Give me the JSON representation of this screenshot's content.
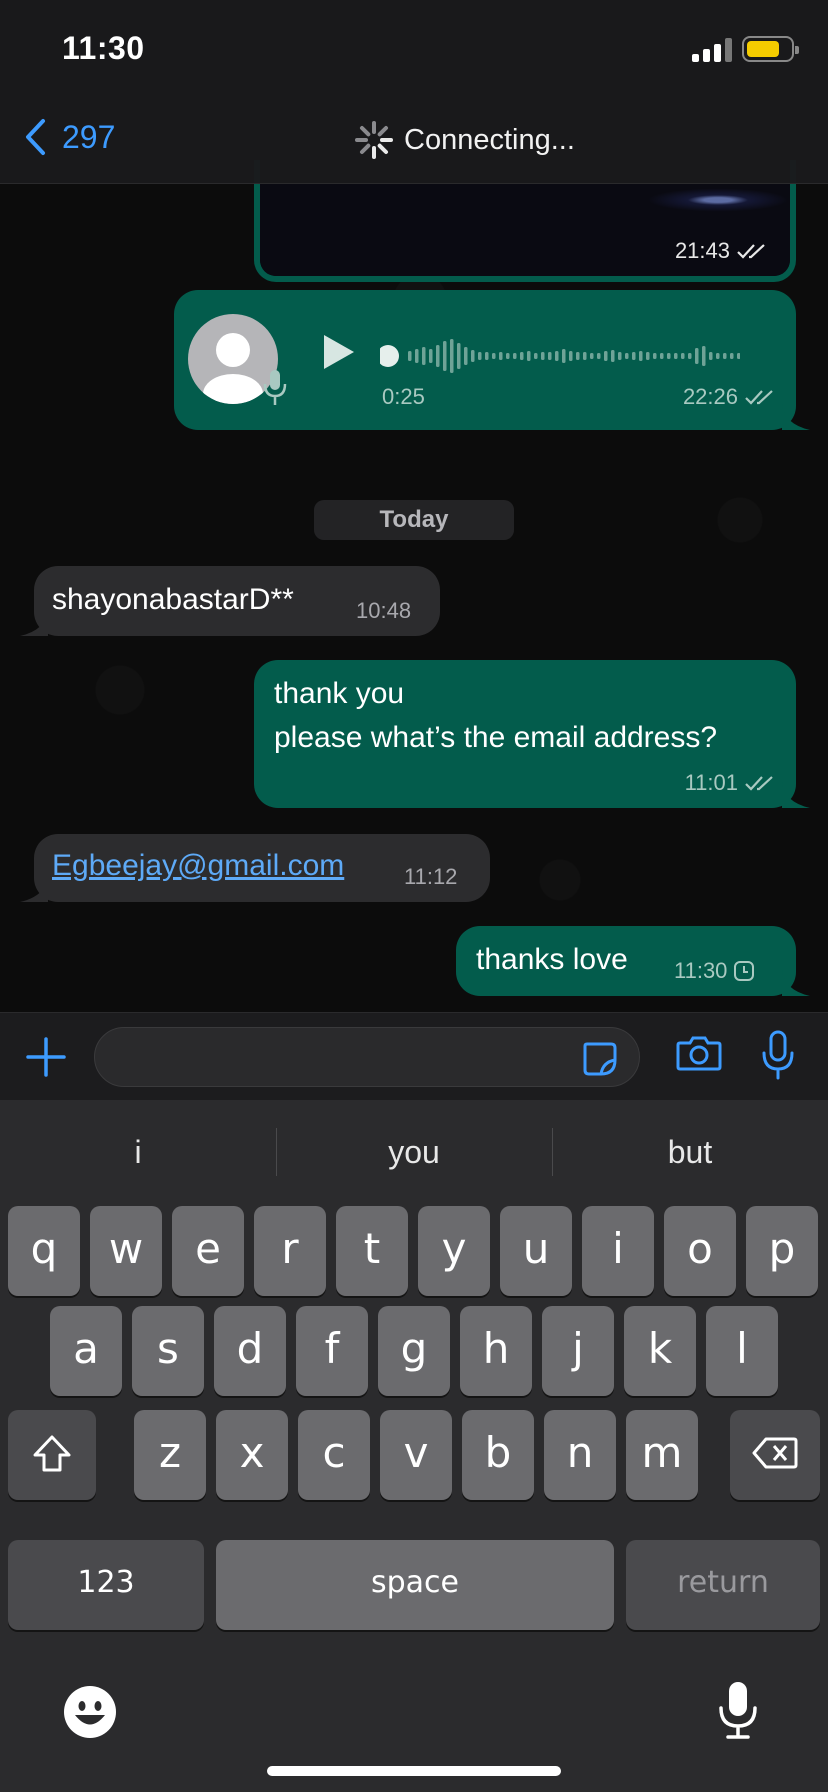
{
  "status_bar": {
    "time": "11:30"
  },
  "header": {
    "back_count": "297",
    "connection_status": "Connecting..."
  },
  "messages": {
    "media": {
      "time": "21:43"
    },
    "voice": {
      "duration": "0:25",
      "time": "22:26"
    },
    "date_separator": "Today",
    "m1": {
      "text": "shayonabastarD**",
      "time": "10:48"
    },
    "m2": {
      "text": "thank you\nplease what’s the email address?",
      "time": "11:01"
    },
    "m3": {
      "text": "Egbeejay@gmail.com",
      "time": "11:12"
    },
    "m4": {
      "text": "thanks love",
      "time": "11:30"
    }
  },
  "keyboard": {
    "suggestions": [
      "i",
      "you",
      "but"
    ],
    "row1": [
      "q",
      "w",
      "e",
      "r",
      "t",
      "y",
      "u",
      "i",
      "o",
      "p"
    ],
    "row2": [
      "a",
      "s",
      "d",
      "f",
      "g",
      "h",
      "j",
      "k",
      "l"
    ],
    "row3": [
      "z",
      "x",
      "c",
      "v",
      "b",
      "n",
      "m"
    ],
    "numbers_label": "123",
    "space_label": "space",
    "return_label": "return"
  },
  "colors": {
    "accent": "#3d9bff",
    "outgoing_bubble": "#035c4c",
    "incoming_bubble": "#2c2c2e",
    "battery": "#f5cc00"
  }
}
